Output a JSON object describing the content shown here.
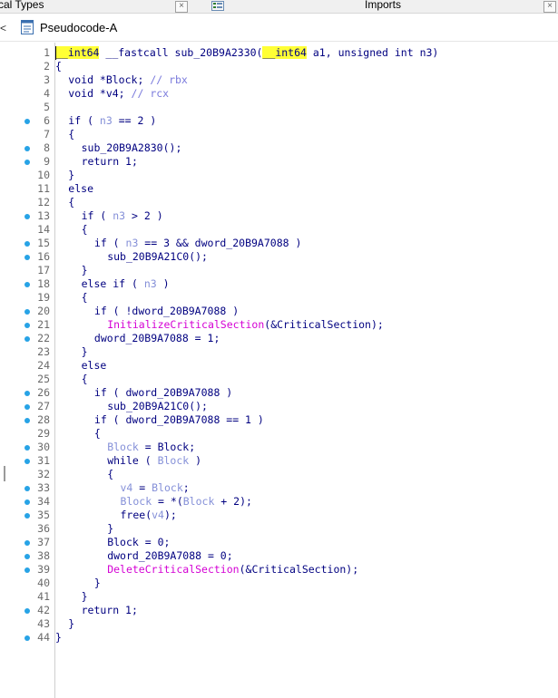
{
  "tabs": {
    "left_label": "cal Types",
    "right_label": "Imports",
    "close_symbol": "×"
  },
  "subtab": {
    "title": "Pseudocode-A",
    "left_icon": "<"
  },
  "colors": {
    "dot": "#27a3e6",
    "keyword": "#000080",
    "variable": "#8590d8",
    "macro": "#d400d4",
    "highlight": "#ffff35"
  },
  "code_lines": [
    {
      "n": "1",
      "dot": false,
      "indent": 0,
      "tokens": [
        [
          "hl",
          "__int64"
        ],
        [
          "k",
          " __fastcall sub_20B9A2330("
        ],
        [
          "hl",
          "__int64"
        ],
        [
          "k",
          " a1, unsigned int n3)"
        ]
      ]
    },
    {
      "n": "2",
      "dot": false,
      "indent": 0,
      "tokens": [
        [
          "k",
          "{"
        ]
      ]
    },
    {
      "n": "3",
      "dot": false,
      "indent": 1,
      "tokens": [
        [
          "k",
          "void *Block; "
        ],
        [
          "c",
          "// rbx"
        ]
      ]
    },
    {
      "n": "4",
      "dot": false,
      "indent": 1,
      "tokens": [
        [
          "k",
          "void *v4; "
        ],
        [
          "c",
          "// rcx"
        ]
      ]
    },
    {
      "n": "5",
      "dot": false,
      "indent": 0,
      "tokens": []
    },
    {
      "n": "6",
      "dot": true,
      "indent": 1,
      "tokens": [
        [
          "k",
          "if ( "
        ],
        [
          "v",
          "n3"
        ],
        [
          "k",
          " == 2 )"
        ]
      ]
    },
    {
      "n": "7",
      "dot": false,
      "indent": 1,
      "tokens": [
        [
          "k",
          "{"
        ]
      ]
    },
    {
      "n": "8",
      "dot": true,
      "indent": 2,
      "tokens": [
        [
          "k",
          "sub_20B9A2830();"
        ]
      ]
    },
    {
      "n": "9",
      "dot": true,
      "indent": 2,
      "tokens": [
        [
          "k",
          "return 1;"
        ]
      ]
    },
    {
      "n": "10",
      "dot": false,
      "indent": 1,
      "tokens": [
        [
          "k",
          "}"
        ]
      ]
    },
    {
      "n": "11",
      "dot": false,
      "indent": 1,
      "tokens": [
        [
          "k",
          "else"
        ]
      ]
    },
    {
      "n": "12",
      "dot": false,
      "indent": 1,
      "tokens": [
        [
          "k",
          "{"
        ]
      ]
    },
    {
      "n": "13",
      "dot": true,
      "indent": 2,
      "tokens": [
        [
          "k",
          "if ( "
        ],
        [
          "v",
          "n3"
        ],
        [
          "k",
          " > 2 )"
        ]
      ]
    },
    {
      "n": "14",
      "dot": false,
      "indent": 2,
      "tokens": [
        [
          "k",
          "{"
        ]
      ]
    },
    {
      "n": "15",
      "dot": true,
      "indent": 3,
      "tokens": [
        [
          "k",
          "if ( "
        ],
        [
          "v",
          "n3"
        ],
        [
          "k",
          " == 3 && dword_20B9A7088 )"
        ]
      ]
    },
    {
      "n": "16",
      "dot": true,
      "indent": 4,
      "tokens": [
        [
          "k",
          "sub_20B9A21C0();"
        ]
      ]
    },
    {
      "n": "17",
      "dot": false,
      "indent": 2,
      "tokens": [
        [
          "k",
          "}"
        ]
      ]
    },
    {
      "n": "18",
      "dot": true,
      "indent": 2,
      "tokens": [
        [
          "k",
          "else if ( "
        ],
        [
          "v",
          "n3"
        ],
        [
          "k",
          " )"
        ]
      ]
    },
    {
      "n": "19",
      "dot": false,
      "indent": 2,
      "tokens": [
        [
          "k",
          "{"
        ]
      ]
    },
    {
      "n": "20",
      "dot": true,
      "indent": 3,
      "tokens": [
        [
          "k",
          "if ( !dword_20B9A7088 )"
        ]
      ]
    },
    {
      "n": "21",
      "dot": true,
      "indent": 4,
      "tokens": [
        [
          "m",
          "InitializeCriticalSection"
        ],
        [
          "k",
          "(&CriticalSection);"
        ]
      ]
    },
    {
      "n": "22",
      "dot": true,
      "indent": 3,
      "tokens": [
        [
          "k",
          "dword_20B9A7088 = 1;"
        ]
      ]
    },
    {
      "n": "23",
      "dot": false,
      "indent": 2,
      "tokens": [
        [
          "k",
          "}"
        ]
      ]
    },
    {
      "n": "24",
      "dot": false,
      "indent": 2,
      "tokens": [
        [
          "k",
          "else"
        ]
      ]
    },
    {
      "n": "25",
      "dot": false,
      "indent": 2,
      "tokens": [
        [
          "k",
          "{"
        ]
      ]
    },
    {
      "n": "26",
      "dot": true,
      "indent": 3,
      "tokens": [
        [
          "k",
          "if ( dword_20B9A7088 )"
        ]
      ]
    },
    {
      "n": "27",
      "dot": true,
      "indent": 4,
      "tokens": [
        [
          "k",
          "sub_20B9A21C0();"
        ]
      ]
    },
    {
      "n": "28",
      "dot": true,
      "indent": 3,
      "tokens": [
        [
          "k",
          "if ( dword_20B9A7088 == 1 )"
        ]
      ]
    },
    {
      "n": "29",
      "dot": false,
      "indent": 3,
      "tokens": [
        [
          "k",
          "{"
        ]
      ]
    },
    {
      "n": "30",
      "dot": true,
      "indent": 4,
      "tokens": [
        [
          "v",
          "Block"
        ],
        [
          "k",
          " = Block;"
        ]
      ]
    },
    {
      "n": "31",
      "dot": true,
      "indent": 4,
      "tokens": [
        [
          "k",
          "while ( "
        ],
        [
          "v",
          "Block"
        ],
        [
          "k",
          " )"
        ]
      ]
    },
    {
      "n": "32",
      "dot": false,
      "indent": 4,
      "tokens": [
        [
          "k",
          "{"
        ]
      ]
    },
    {
      "n": "33",
      "dot": true,
      "indent": 5,
      "tokens": [
        [
          "v",
          "v4"
        ],
        [
          "k",
          " = "
        ],
        [
          "v",
          "Block"
        ],
        [
          "k",
          ";"
        ]
      ]
    },
    {
      "n": "34",
      "dot": true,
      "indent": 5,
      "tokens": [
        [
          "v",
          "Block"
        ],
        [
          "k",
          " = *("
        ],
        [
          "v",
          "Block"
        ],
        [
          "k",
          " + 2);"
        ]
      ]
    },
    {
      "n": "35",
      "dot": true,
      "indent": 5,
      "tokens": [
        [
          "k",
          "free("
        ],
        [
          "v",
          "v4"
        ],
        [
          "k",
          ");"
        ]
      ]
    },
    {
      "n": "36",
      "dot": false,
      "indent": 4,
      "tokens": [
        [
          "k",
          "}"
        ]
      ]
    },
    {
      "n": "37",
      "dot": true,
      "indent": 4,
      "tokens": [
        [
          "k",
          "Block = 0;"
        ]
      ]
    },
    {
      "n": "38",
      "dot": true,
      "indent": 4,
      "tokens": [
        [
          "k",
          "dword_20B9A7088 = 0;"
        ]
      ]
    },
    {
      "n": "39",
      "dot": true,
      "indent": 4,
      "tokens": [
        [
          "m",
          "DeleteCriticalSection"
        ],
        [
          "k",
          "(&CriticalSection);"
        ]
      ]
    },
    {
      "n": "40",
      "dot": false,
      "indent": 3,
      "tokens": [
        [
          "k",
          "}"
        ]
      ]
    },
    {
      "n": "41",
      "dot": false,
      "indent": 2,
      "tokens": [
        [
          "k",
          "}"
        ]
      ]
    },
    {
      "n": "42",
      "dot": true,
      "indent": 2,
      "tokens": [
        [
          "k",
          "return 1;"
        ]
      ]
    },
    {
      "n": "43",
      "dot": false,
      "indent": 1,
      "tokens": [
        [
          "k",
          "}"
        ]
      ]
    },
    {
      "n": "44",
      "dot": true,
      "indent": 0,
      "tokens": [
        [
          "k",
          "}"
        ]
      ]
    }
  ]
}
